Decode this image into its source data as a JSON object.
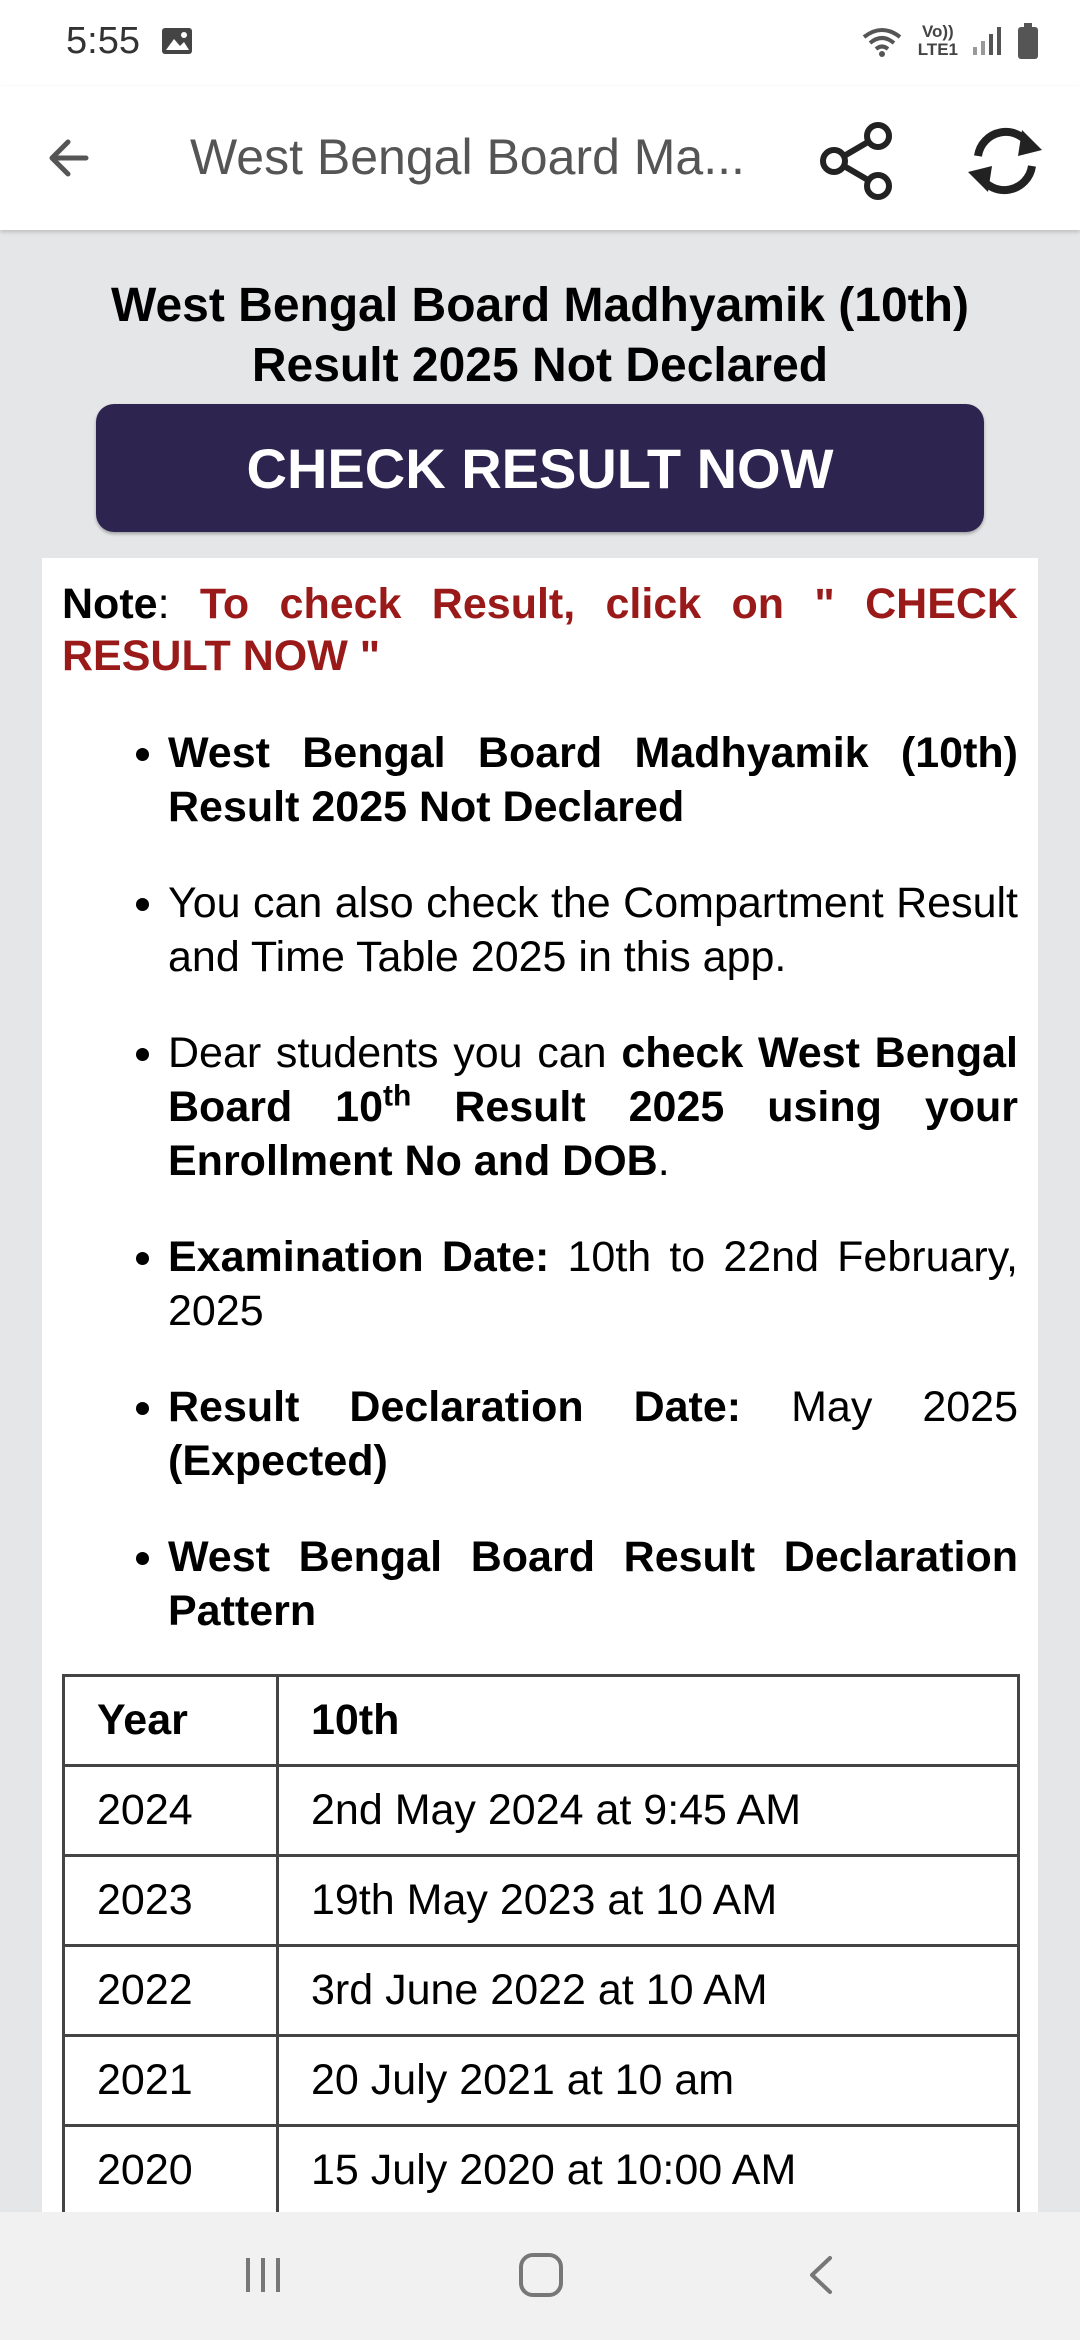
{
  "status_bar": {
    "time": "5:55",
    "lte_top": "Vo))",
    "lte_bottom": "LTE1"
  },
  "app_bar": {
    "title": "West Bengal Board Ma..."
  },
  "headline": {
    "line1": "West Bengal Board Madhyamik (10th)",
    "line2": "Result 2025 Not Declared"
  },
  "cta": {
    "label": "CHECK RESULT NOW"
  },
  "note": {
    "key": "Note",
    "sep": ": ",
    "text": "To check Result, click on \" CHECK RESULT NOW \""
  },
  "bullets": {
    "b1": "West Bengal Board Madhyamik (10th) Result 2025 Not Declared",
    "b2": "You can also check the Compartment Result and Time Table 2025 in this app.",
    "b3_plain": "Dear students you can ",
    "b3_bold_a": "check West Bengal Board 10",
    "b3_sup": "th",
    "b3_bold_b": " Result 2025 using your Enrollment No and DOB",
    "b3_end": ".",
    "b4_label": "Examination Date:",
    "b4_value": " 10th to 22nd February, 2025",
    "b5_label": "Result Declaration Date:",
    "b5_value": " May 2025 ",
    "b5_bold": "(Expected)",
    "b6": "West Bengal Board Result Declaration Pattern"
  },
  "table": {
    "headers": [
      "Year",
      "10th"
    ],
    "rows": [
      [
        "2024",
        "2nd May 2024 at 9:45 AM"
      ],
      [
        "2023",
        "19th May 2023 at 10 AM"
      ],
      [
        "2022",
        "3rd June 2022 at 10 AM"
      ],
      [
        "2021",
        "20 July 2021 at 10 am"
      ],
      [
        "2020",
        "15 July 2020 at 10:00 AM"
      ]
    ]
  },
  "colors": {
    "cta_bg": "#2e2450",
    "note_red": "#9a1a1a",
    "page_bg": "#e4e6e7"
  },
  "icons": {
    "back": "arrow-left-icon",
    "share": "share-icon",
    "refresh": "refresh-icon",
    "gallery": "image-icon",
    "wifi": "wifi-icon",
    "signal": "signal-icon",
    "battery": "battery-icon"
  }
}
